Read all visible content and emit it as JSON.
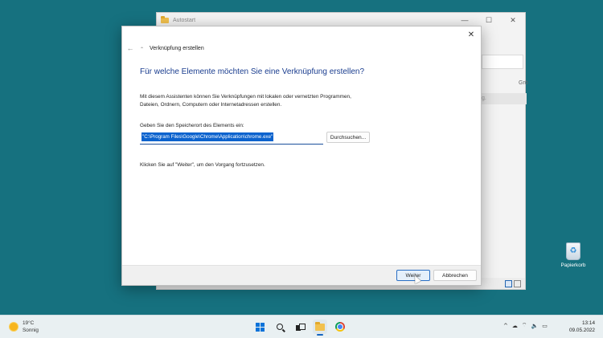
{
  "explorer": {
    "title": "Autostart",
    "column_header": "Grö",
    "row_fragment": "g.",
    "controls": {
      "minimize": "—",
      "maximize": "☐",
      "close": "✕"
    }
  },
  "dialog": {
    "title": "Verknüpfung erstellen",
    "close_icon": "✕",
    "back_icon": "←",
    "heading": "Für welche Elemente möchten Sie eine Verknüpfung erstellen?",
    "intro_line1": "Mit diesem Assistenten können Sie Verknüpfungen mit lokalen oder vernetzten Programmen,",
    "intro_line2": "Dateien, Ordnern, Computern oder Internetadressen erstellen.",
    "location_label": "Geben Sie den Speicherort des Elements ein:",
    "location_value": "\"C:\\Program Files\\Google\\Chrome\\Application\\chrome.exe\"",
    "browse_button": "Durchsuchen...",
    "hint": "Klicken Sie auf \"Weiter\", um den Vorgang fortzusetzen.",
    "next_button": "Weiter",
    "cancel_button": "Abbrechen"
  },
  "desktop": {
    "recycle_bin_label": "Papierkorb"
  },
  "taskbar": {
    "weather_temp": "19°C",
    "weather_desc": "Sonnig",
    "apps": [
      "start",
      "search",
      "task-view",
      "file-explorer",
      "chrome"
    ],
    "tray": {
      "chevron": "^",
      "wifi": "wifi",
      "volume": "volume",
      "battery": "battery"
    },
    "time": "13:14",
    "date": "09.05.2022"
  },
  "colors": {
    "desktop_background": "#16717f",
    "heading_blue": "#1a3d8f",
    "selection_blue": "#0c63ce",
    "taskbar": "#e9f0f2"
  }
}
